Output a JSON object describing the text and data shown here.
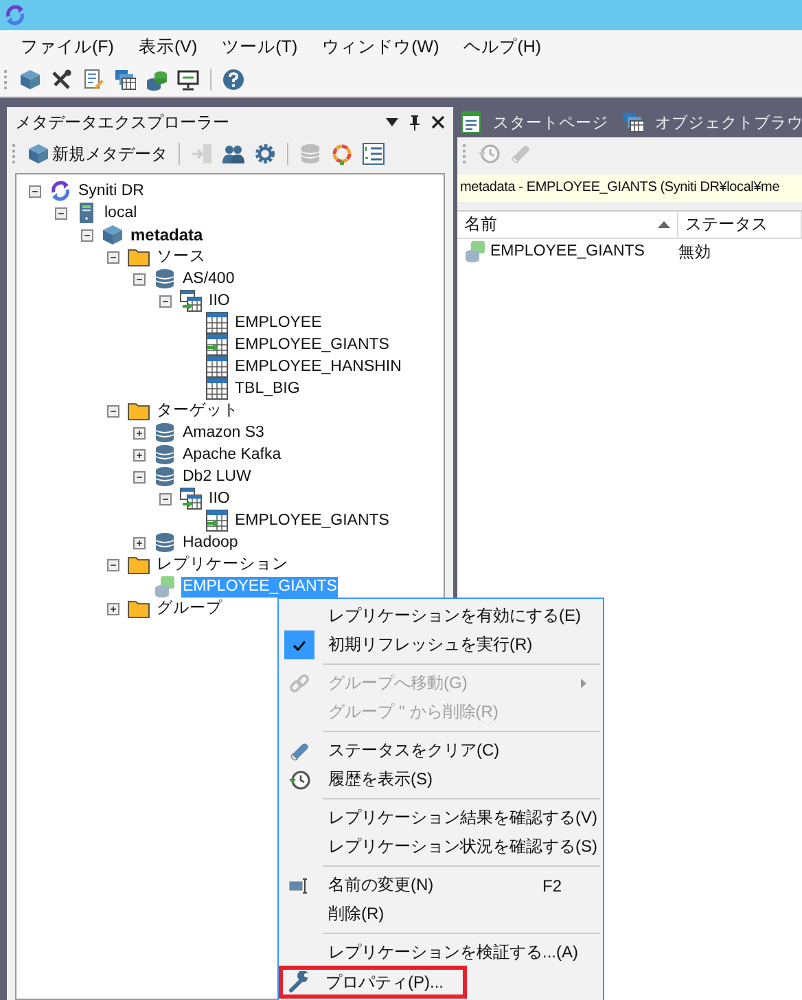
{
  "menu_bar": [
    "ファイル(F)",
    "表示(V)",
    "ツール(T)",
    "ウィンドウ(W)",
    "ヘルプ(H)"
  ],
  "toolbar": [
    {
      "kind": "cube",
      "disabled": false
    },
    {
      "kind": "tools",
      "disabled": false
    },
    {
      "kind": "edit",
      "disabled": false
    },
    {
      "kind": "tables",
      "disabled": false
    },
    {
      "kind": "databases",
      "disabled": false
    },
    {
      "kind": "monitor",
      "disabled": false
    },
    {
      "kind": "separator"
    },
    {
      "kind": "help",
      "disabled": false
    }
  ],
  "explorer": {
    "title": "メタデータエクスプローラー",
    "new_button": "新規メタデータ",
    "toolbar": [
      {
        "kind": "exit",
        "disabled": true
      },
      {
        "kind": "users",
        "disabled": false
      },
      {
        "kind": "gear",
        "disabled": false
      },
      {
        "kind": "separator"
      },
      {
        "kind": "database",
        "disabled": true
      },
      {
        "kind": "ring",
        "disabled": false
      },
      {
        "kind": "list",
        "disabled": false
      }
    ],
    "tree": [
      {
        "label": "Syniti DR",
        "kind": "cycle",
        "expanded": true,
        "selected": false,
        "children": [
          {
            "label": "local",
            "kind": "server",
            "expanded": true,
            "selected": false,
            "children": [
              {
                "label": "metadata",
                "kind": "cube",
                "expanded": true,
                "selected": false,
                "bold": true,
                "children": [
                  {
                    "label": "ソース",
                    "kind": "folder",
                    "expanded": true,
                    "selected": false,
                    "children": [
                      {
                        "label": "AS/400",
                        "kind": "database",
                        "expanded": true,
                        "selected": false,
                        "children": [
                          {
                            "label": "IIO",
                            "kind": "schema",
                            "expanded": true,
                            "selected": false,
                            "children": [
                              {
                                "label": "EMPLOYEE",
                                "kind": "table",
                                "selected": false
                              },
                              {
                                "label": "EMPLOYEE_GIANTS",
                                "kind": "table-arrow",
                                "selected": false
                              },
                              {
                                "label": "EMPLOYEE_HANSHIN",
                                "kind": "table",
                                "selected": false
                              },
                              {
                                "label": "TBL_BIG",
                                "kind": "table",
                                "selected": false
                              }
                            ]
                          }
                        ]
                      }
                    ]
                  },
                  {
                    "label": "ターゲット",
                    "kind": "folder",
                    "expanded": true,
                    "selected": false,
                    "children": [
                      {
                        "label": "Amazon S3",
                        "kind": "database",
                        "expanded": false,
                        "selected": false
                      },
                      {
                        "label": "Apache Kafka",
                        "kind": "database",
                        "expanded": false,
                        "selected": false
                      },
                      {
                        "label": "Db2 LUW",
                        "kind": "database",
                        "expanded": true,
                        "selected": false,
                        "children": [
                          {
                            "label": "IIO",
                            "kind": "schema",
                            "expanded": true,
                            "selected": false,
                            "children": [
                              {
                                "label": "EMPLOYEE_GIANTS",
                                "kind": "table-arrow",
                                "selected": false
                              }
                            ]
                          }
                        ]
                      },
                      {
                        "label": "Hadoop",
                        "kind": "database",
                        "expanded": false,
                        "selected": false
                      }
                    ]
                  },
                  {
                    "label": "レプリケーション",
                    "kind": "folder",
                    "expanded": true,
                    "selected": false,
                    "children": [
                      {
                        "label": "EMPLOYEE_GIANTS",
                        "kind": "replication",
                        "selected": true
                      }
                    ]
                  },
                  {
                    "label": "グループ",
                    "kind": "folder",
                    "expanded": false,
                    "selected": false
                  }
                ]
              }
            ]
          }
        ]
      }
    ]
  },
  "tabs": [
    {
      "label": "スタートページ",
      "kind": "page",
      "selected": false
    },
    {
      "label": "オブジェクトブラウ",
      "kind": "tables",
      "selected": false
    }
  ],
  "right_toolbar": [
    {
      "kind": "history",
      "disabled": true
    },
    {
      "kind": "eraser",
      "disabled": true
    }
  ],
  "info_bar": "metadata - EMPLOYEE_GIANTS (Syniti DR¥local¥me",
  "table": {
    "columns": [
      {
        "label": "名前",
        "sorted": true
      },
      {
        "label": "ステータス",
        "sorted": false
      }
    ],
    "rows": [
      {
        "cells": [
          "EMPLOYEE_GIANTS",
          "無効"
        ]
      }
    ]
  },
  "context_menu": [
    {
      "kind": "plain",
      "label": "レプリケーションを有効にする(E)",
      "disabled": false,
      "checked": false
    },
    {
      "kind": "plain",
      "label": "初期リフレッシュを実行(R)",
      "disabled": false,
      "checked": true
    },
    {
      "kind": "separator"
    },
    {
      "kind": "link",
      "label": "グループへ移動(G)",
      "disabled": true,
      "checked": false,
      "submenu": true
    },
    {
      "kind": "plain",
      "label": "グループ '' から削除(R)",
      "disabled": true,
      "checked": false
    },
    {
      "kind": "separator"
    },
    {
      "kind": "eraser",
      "label": "ステータスをクリア(C)",
      "disabled": false,
      "checked": false
    },
    {
      "kind": "history",
      "label": "履歴を表示(S)",
      "disabled": false,
      "checked": false
    },
    {
      "kind": "separator"
    },
    {
      "kind": "plain",
      "label": "レプリケーション結果を確認する(V)",
      "disabled": false,
      "checked": false
    },
    {
      "kind": "plain",
      "label": "レプリケーション状況を確認する(S)",
      "disabled": false,
      "checked": false
    },
    {
      "kind": "separator"
    },
    {
      "kind": "rename",
      "label": "名前の変更(N)",
      "shortcut": "F2",
      "disabled": false,
      "checked": false
    },
    {
      "kind": "plain",
      "label": "削除(R)",
      "disabled": false,
      "checked": false
    },
    {
      "kind": "separator"
    },
    {
      "kind": "plain",
      "label": "レプリケーションを検証する...(A)",
      "disabled": false,
      "checked": false
    },
    {
      "kind": "wrench",
      "label": "プロパティ(P)...",
      "disabled": false,
      "checked": false,
      "annotated": true
    }
  ]
}
